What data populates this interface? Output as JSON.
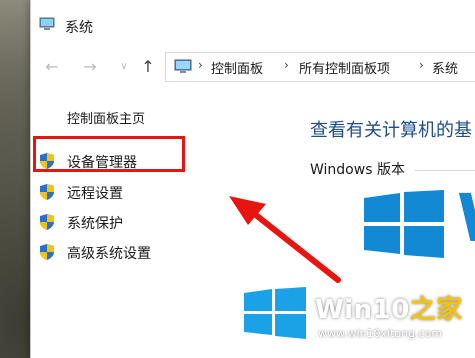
{
  "window": {
    "title": "系统"
  },
  "navigation": {
    "back_icon": "arrow-left-icon",
    "forward_icon": "arrow-right-icon",
    "history_icon": "chevron-down-icon",
    "up_icon": "arrow-up-icon"
  },
  "address_bar": {
    "crumbs": [
      "控制面板",
      "所有控制面板项",
      "系统"
    ]
  },
  "sidebar": {
    "home_label": "控制面板主页",
    "items": [
      {
        "label": "设备管理器",
        "icon": "shield-icon"
      },
      {
        "label": "远程设置",
        "icon": "shield-icon"
      },
      {
        "label": "系统保护",
        "icon": "shield-icon"
      },
      {
        "label": "高级系统设置",
        "icon": "shield-icon"
      }
    ]
  },
  "main": {
    "heading": "查看有关计算机的基",
    "section_label": "Windows 版本",
    "logo_letter": "W"
  },
  "colors": {
    "highlight": "#e8140f",
    "heading": "#1e4e8c",
    "windows_blue": "#1389d4"
  },
  "watermark": {
    "brand": "Win10",
    "brand_suffix": "之家",
    "url": "www.win10xitong.com"
  }
}
